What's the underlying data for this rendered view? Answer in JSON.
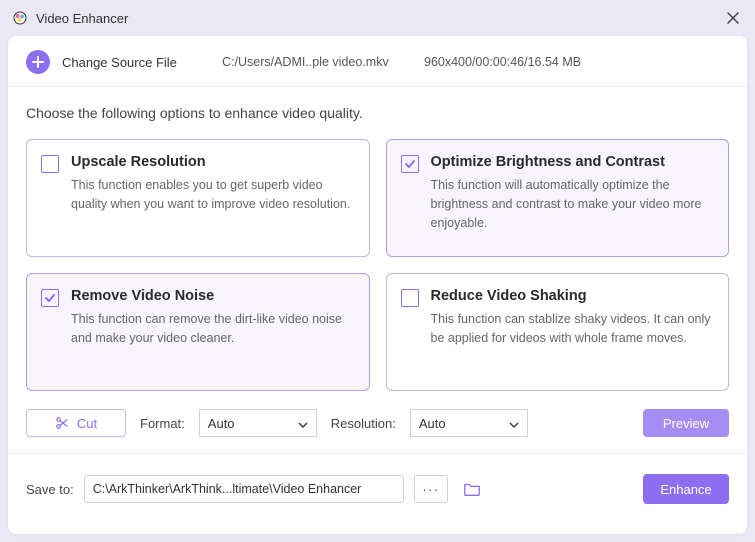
{
  "window": {
    "title": "Video Enhancer"
  },
  "source": {
    "change_label": "Change Source File",
    "path": "C:/Users/ADMI..ple video.mkv",
    "meta": "960x400/00:00:46/16.54 MB"
  },
  "instruction": "Choose the following options to enhance video quality.",
  "options": [
    {
      "key": "upscale",
      "checked": false,
      "title": "Upscale Resolution",
      "desc": "This function enables you to get superb video quality when you want to improve video resolution."
    },
    {
      "key": "brightness",
      "checked": true,
      "title": "Optimize Brightness and Contrast",
      "desc": "This function will automatically optimize the brightness and contrast to make your video more enjoyable."
    },
    {
      "key": "noise",
      "checked": true,
      "title": "Remove Video Noise",
      "desc": "This function can remove the dirt-like video noise and make your video cleaner."
    },
    {
      "key": "shaking",
      "checked": false,
      "title": "Reduce Video Shaking",
      "desc": "This function can stablize shaky videos. It can only be applied for videos with whole frame moves."
    }
  ],
  "controls": {
    "cut_label": "Cut",
    "format_label": "Format:",
    "format_value": "Auto",
    "resolution_label": "Resolution:",
    "resolution_value": "Auto",
    "preview_label": "Preview"
  },
  "save": {
    "label": "Save to:",
    "path": "C:\\ArkThinker\\ArkThink...ltimate\\Video Enhancer",
    "dots": "···",
    "enhance_label": "Enhance"
  }
}
